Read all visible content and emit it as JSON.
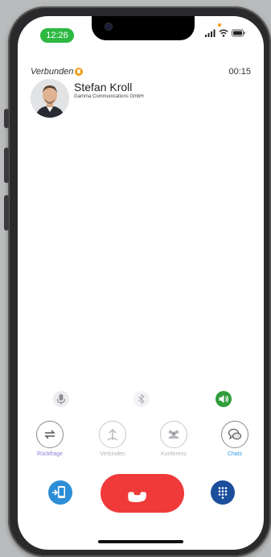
{
  "status_bar": {
    "time": "12:26",
    "icons": [
      "signal-icon",
      "wifi-icon",
      "battery-icon"
    ]
  },
  "call": {
    "status": "Verbunden",
    "duration": "00:15",
    "contact_name": "Stefan Kroll",
    "company": "Gamma Communications GmbH"
  },
  "controls": [
    {
      "name": "mute-microphone-icon"
    },
    {
      "name": "bluetooth-icon"
    },
    {
      "name": "speaker-icon"
    }
  ],
  "actions": [
    {
      "label": "Rückfrage",
      "icon": "consult-icon",
      "enabled": true,
      "color": "#8a7fd0"
    },
    {
      "label": "Verbinden",
      "icon": "transfer-icon",
      "enabled": false,
      "color": "#b5b5b9"
    },
    {
      "label": "Konferenz",
      "icon": "conference-icon",
      "enabled": false,
      "color": "#b5b5b9"
    },
    {
      "label": "Chats",
      "icon": "chat-icon",
      "enabled": true,
      "color": "#2e9de0"
    }
  ],
  "bottom_buttons": {
    "switch_device_icon": "switch-device-icon",
    "hangup_icon": "hangup-phone-icon",
    "keypad_icon": "keypad-icon"
  },
  "colors": {
    "hangup": "#f03a3a",
    "accent_blue": "#1b76c9",
    "time_pill": "#2db842",
    "speaker_active": "#2f9e3a"
  }
}
